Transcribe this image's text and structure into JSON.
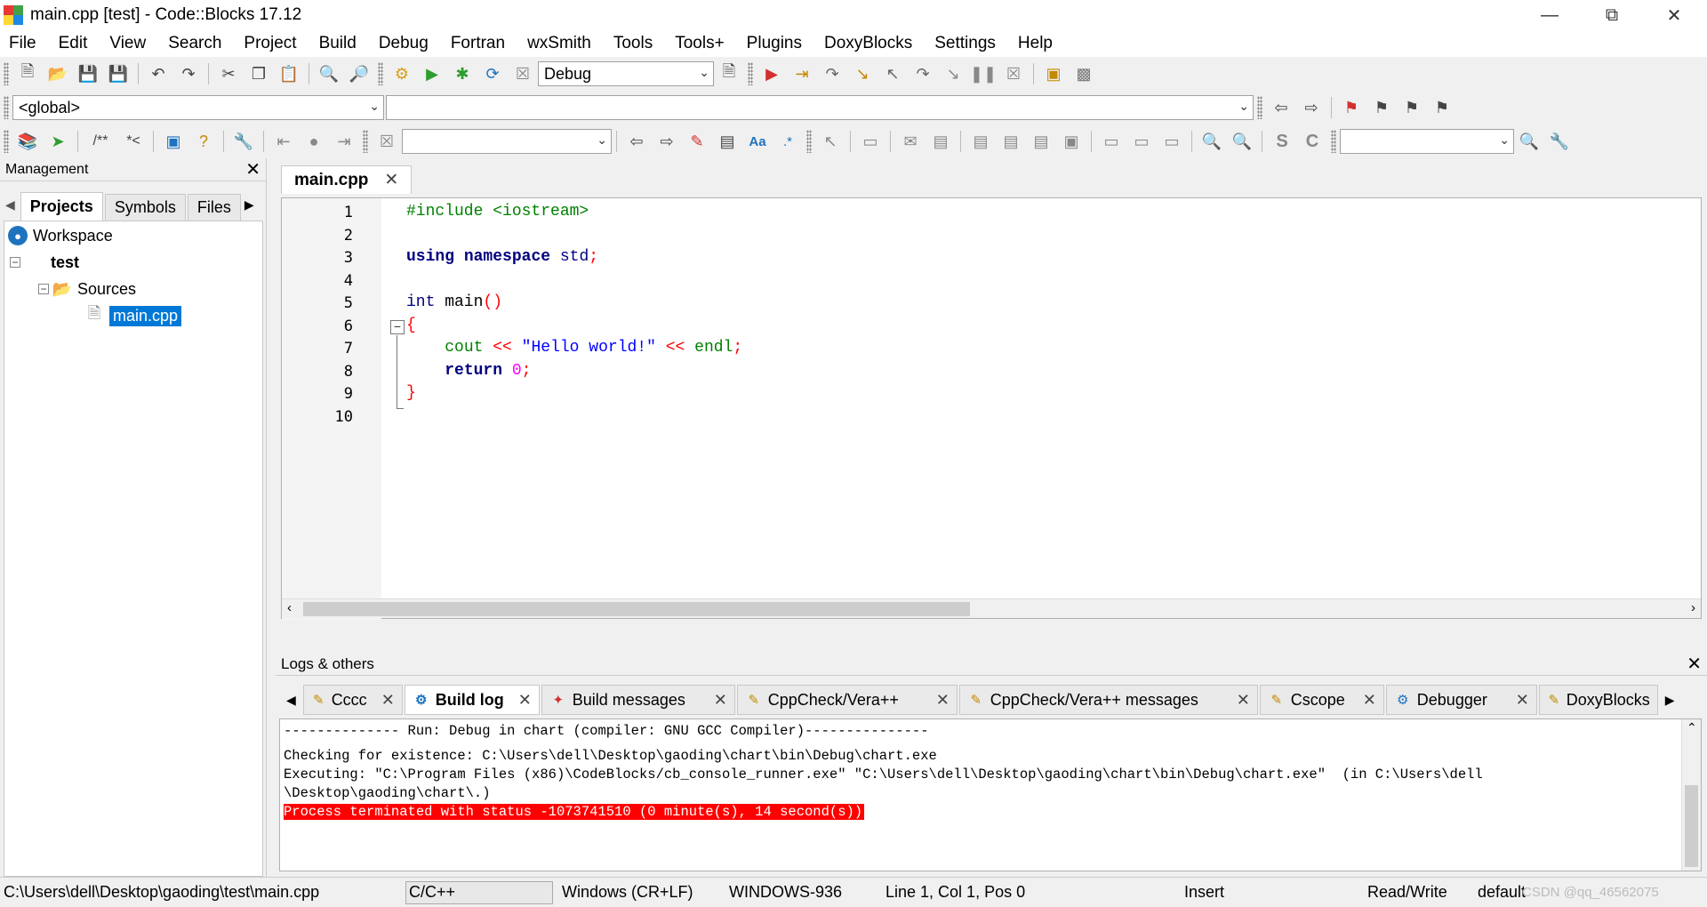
{
  "window": {
    "title": "main.cpp [test] - Code::Blocks 17.12"
  },
  "menu": [
    "File",
    "Edit",
    "View",
    "Search",
    "Project",
    "Build",
    "Debug",
    "Fortran",
    "wxSmith",
    "Tools",
    "Tools+",
    "Plugins",
    "DoxyBlocks",
    "Settings",
    "Help"
  ],
  "toolbar": {
    "build_target": "Debug",
    "scope": "<global>"
  },
  "management": {
    "title": "Management",
    "tabs": [
      "Projects",
      "Symbols",
      "Files"
    ],
    "tree": {
      "workspace": "Workspace",
      "project": "test",
      "folder": "Sources",
      "file": "main.cpp"
    }
  },
  "editor": {
    "tab": "main.cpp",
    "line_numbers": [
      "1",
      "2",
      "3",
      "4",
      "5",
      "6",
      "7",
      "8",
      "9",
      "10"
    ]
  },
  "logs": {
    "title": "Logs & others",
    "tabs": [
      "Cccc",
      "Build log",
      "Build messages",
      "CppCheck/Vera++",
      "CppCheck/Vera++ messages",
      "Cscope",
      "Debugger",
      "DoxyBlocks"
    ],
    "lines": [
      "-------------- Run: Debug in chart (compiler: GNU GCC Compiler)---------------",
      "Checking for existence: C:\\Users\\dell\\Desktop\\gaoding\\chart\\bin\\Debug\\chart.exe",
      "Executing: \"C:\\Program Files (x86)\\CodeBlocks/cb_console_runner.exe\" \"C:\\Users\\dell\\Desktop\\gaoding\\chart\\bin\\Debug\\chart.exe\"  (in C:\\Users\\dell",
      "\\Desktop\\gaoding\\chart\\.)",
      "Process terminated with status -1073741510 (0 minute(s), 14 second(s))"
    ]
  },
  "status": {
    "path": "C:\\Users\\dell\\Desktop\\gaoding\\test\\main.cpp",
    "lang": "C/C++",
    "eol": "Windows (CR+LF)",
    "encoding": "WINDOWS-936",
    "position": "Line 1, Col 1, Pos 0",
    "mode": "Insert",
    "access": "Read/Write",
    "profile": "default",
    "watermark": "CSDN @qq_46562075"
  }
}
